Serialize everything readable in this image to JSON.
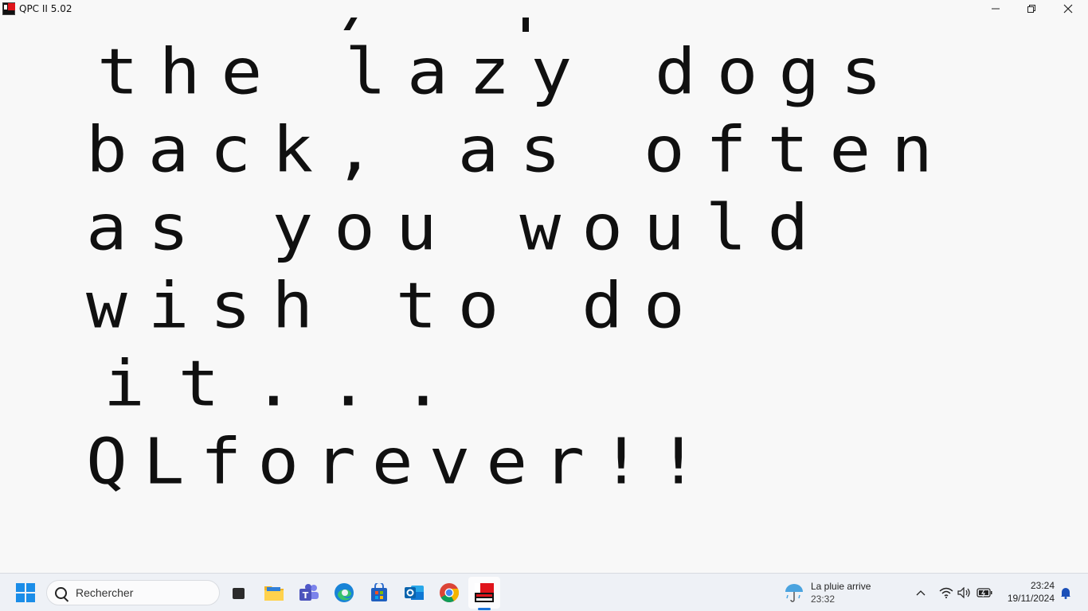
{
  "window": {
    "title": "QPC II 5.02",
    "minimize_icon": "minimize-icon",
    "restore_icon": "restore-icon",
    "close_icon": "close-icon"
  },
  "screen": {
    "lines": [
      "the lazy dogs",
      "back, as often",
      "as you would",
      "wish to do",
      "it...",
      "QLforever!!"
    ]
  },
  "taskbar": {
    "search_placeholder": "Rechercher",
    "apps": [
      "start-icon",
      "task-view-icon",
      "file-explorer-icon",
      "teams-icon",
      "edge-icon",
      "store-icon",
      "outlook-icon",
      "chrome-icon",
      "qpc-icon"
    ],
    "weather": {
      "title": "La pluie arrive",
      "time": "23:32"
    },
    "clock": {
      "time": "23:24",
      "date": "19/11/2024"
    },
    "colors": {
      "accent": "#1a73d9",
      "windows_blue": "#1b8de8"
    }
  }
}
